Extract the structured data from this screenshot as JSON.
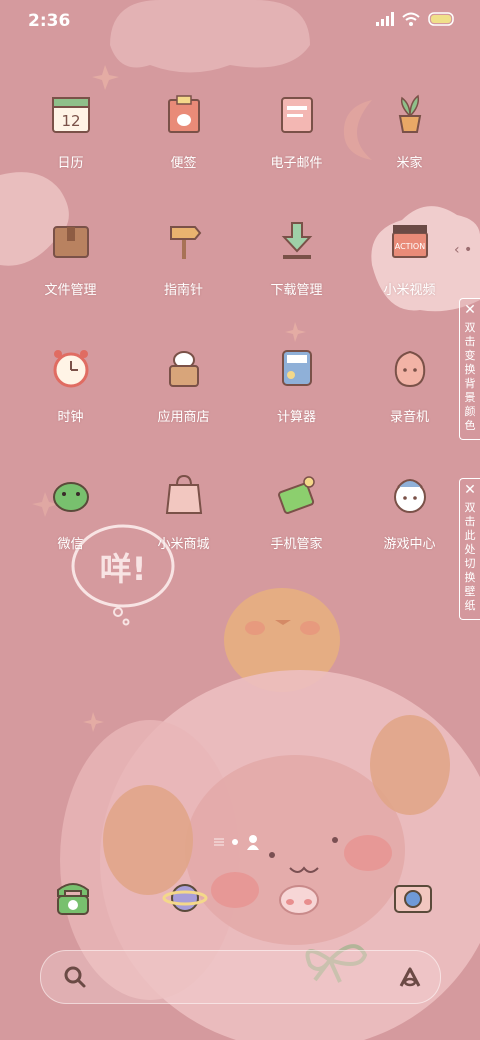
{
  "status_bar": {
    "time": "2:36"
  },
  "apps": [
    {
      "label": "日历",
      "icon": "calendar-icon"
    },
    {
      "label": "便签",
      "icon": "notes-icon"
    },
    {
      "label": "电子邮件",
      "icon": "email-icon"
    },
    {
      "label": "米家",
      "icon": "plant-icon"
    },
    {
      "label": "文件管理",
      "icon": "folder-icon"
    },
    {
      "label": "指南针",
      "icon": "signpost-icon"
    },
    {
      "label": "下载管理",
      "icon": "download-icon"
    },
    {
      "label": "小米视频",
      "icon": "clapper-icon"
    },
    {
      "label": "时钟",
      "icon": "alarm-clock-icon"
    },
    {
      "label": "应用商店",
      "icon": "app-store-icon"
    },
    {
      "label": "计算器",
      "icon": "calculator-icon"
    },
    {
      "label": "录音机",
      "icon": "recorder-icon"
    },
    {
      "label": "微信",
      "icon": "frog-icon"
    },
    {
      "label": "小米商城",
      "icon": "shop-bag-icon"
    },
    {
      "label": "手机管家",
      "icon": "battery-icon"
    },
    {
      "label": "游戏中心",
      "icon": "game-sheep-icon"
    }
  ],
  "side_tabs": {
    "change_color": "双击变换背景颜色",
    "change_wallpaper": "双击此处切换壁纸"
  },
  "bubble_text": "咩!",
  "recorder_label": "ACTION",
  "dock": [
    "phone-icon",
    "planet-icon",
    "message-bun-icon",
    "camera-icon"
  ],
  "colors": {
    "background": "#d59a9e",
    "text": "#ffffff"
  }
}
